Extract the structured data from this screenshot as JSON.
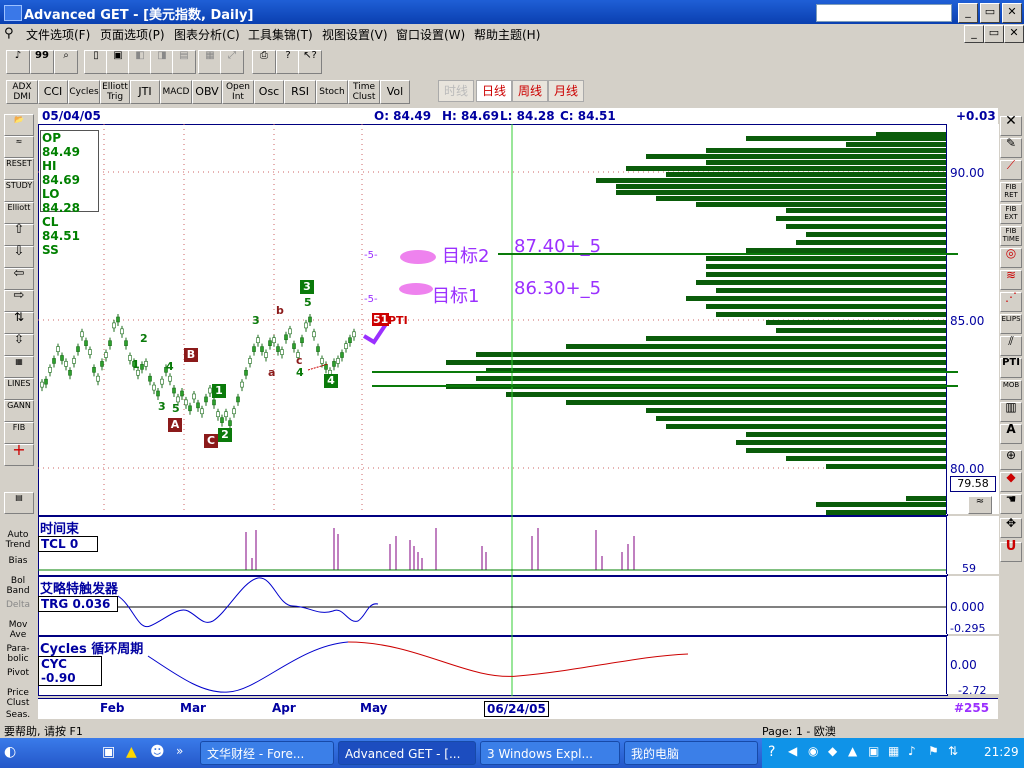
{
  "window": {
    "title": "Advanced GET - [美元指数, Daily]",
    "minimize": "_",
    "restore": "▭",
    "close": "✕"
  },
  "menu": [
    "文件选项(F)",
    "页面选项(P)",
    "图表分析(C)",
    "工具集锦(T)",
    "视图设置(V)",
    "窗口设置(W)",
    "帮助主题(H)"
  ],
  "indicator_buttons": [
    "ADX DMI",
    "CCI",
    "Cycles",
    "Elliott Trig",
    "JTI",
    "MACD",
    "OBV",
    "Open Int",
    "Osc",
    "RSI",
    "Stoch",
    "Time Clust",
    "Vol"
  ],
  "periods": [
    {
      "label": "时线",
      "active": false
    },
    {
      "label": "日线",
      "active": true
    },
    {
      "label": "周线",
      "active": true
    },
    {
      "label": "月线",
      "active": true
    }
  ],
  "header": {
    "date": "05/04/05",
    "open": "O: 84.49",
    "high": "H: 84.69",
    "low": "L: 84.28",
    "close": "C: 84.51",
    "change": "+0.03"
  },
  "ohlc_box": [
    "OP 84.49",
    "HI  84.69",
    "LO  84.28",
    "CL  84.51",
    "SS"
  ],
  "price_scale": {
    "labels": [
      "90.00",
      "85.00",
      "80.00"
    ],
    "current": "79.58",
    "ylim": [
      78.5,
      91.5
    ]
  },
  "annotations": {
    "target2_label": "目标2",
    "target2_value": "87.40+_5",
    "target1_label": "目标1",
    "target1_value": "86.30+_5",
    "wave5_a": "-5-",
    "wave5_b": "-5-",
    "pti": "PTI",
    "pti_num": "51",
    "waves": [
      "A",
      "B",
      "C",
      "1",
      "2",
      "3",
      "4",
      "a",
      "b",
      "c",
      "1",
      "2",
      "3",
      "4",
      "5",
      "3",
      "4",
      "5"
    ]
  },
  "panes": {
    "time_cluster": {
      "title": "时间束",
      "value": "TCL 0",
      "scale": "59"
    },
    "trigger": {
      "title": "艾略特触发器",
      "value": "TRG 0.036",
      "scale_top": "0.000",
      "scale_bottom": "-0.295"
    },
    "cycles": {
      "title": "Cycles 循环周期",
      "value": "CYC -0.90",
      "scale_top": "0.00",
      "scale_bottom": "-2.72"
    }
  },
  "time_axis": {
    "months": [
      "Feb",
      "Mar",
      "Apr",
      "May"
    ],
    "cursor_date": "06/24/05",
    "bar_count": "#255"
  },
  "left_tools": [
    "Auto Trend",
    "Bias",
    "Bol Band",
    "Delta",
    "Mov Ave",
    "Para-bolic",
    "Pivot",
    "Price Clust",
    "Seas."
  ],
  "left_icons": [
    "RESET",
    "STUDY",
    "Elliott",
    "LINES",
    "GANN",
    "FIB"
  ],
  "right_tools": [
    "FIB RET",
    "FIB EXT",
    "FIB TIME",
    "ELIPS",
    "PTI",
    "MOB",
    "A"
  ],
  "status": {
    "help": "要帮助, 请按 F1",
    "page": "Page: 1 - 欧澳"
  },
  "taskbar": {
    "tasks": [
      "文华财经 - Fore...",
      "Advanced GET - [...",
      "3 Windows Expl...",
      "我的电脑"
    ],
    "clock": "21:29"
  },
  "colors": {
    "title_bar": "#0a3fb0",
    "pane_border": "#000080",
    "histogram": "#0a5c0a",
    "candle_up": "#2ca02c",
    "target_text": "#9b30ff",
    "pink_ellipse": "#ee82ee",
    "cycle_blue": "#0000cc",
    "cycle_red": "#cc0000"
  }
}
